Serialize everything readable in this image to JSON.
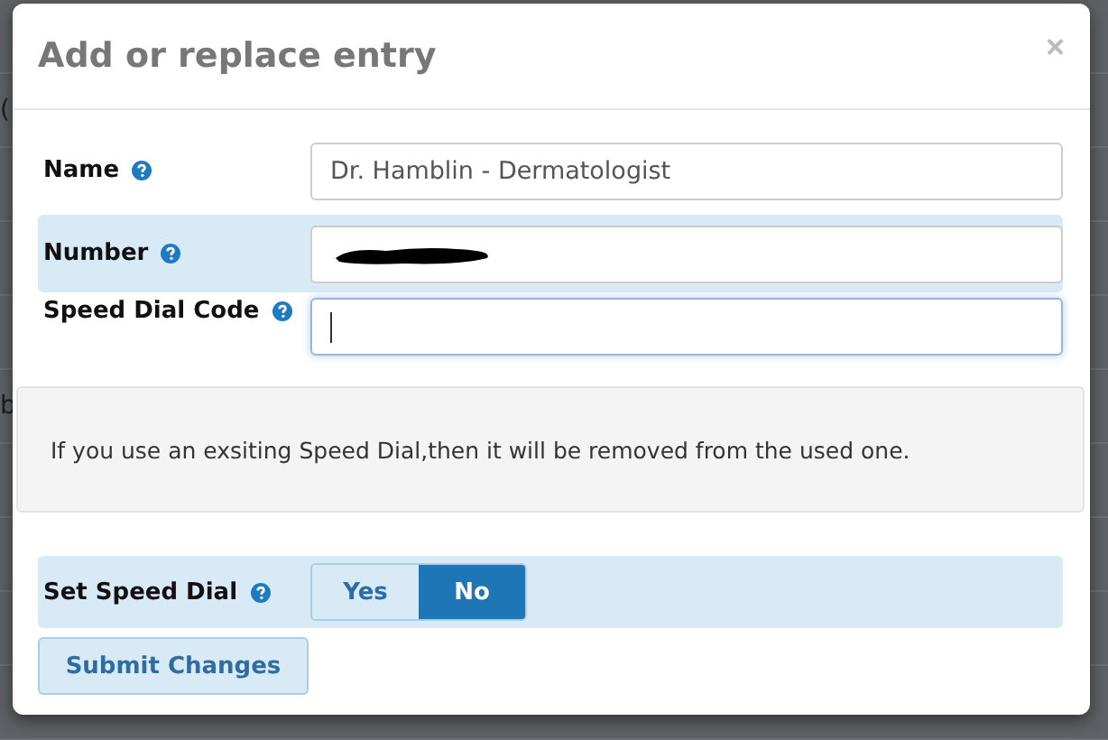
{
  "backdrop": {
    "fragments": [
      "(",
      "b"
    ]
  },
  "dialog": {
    "title": "Add or replace entry",
    "close": "×",
    "fields": [
      {
        "kind": "text",
        "label": "Name",
        "value": "Dr. Hamblin - Dermatologist",
        "highlighted": false,
        "focused": false,
        "redacted": false
      },
      {
        "kind": "text",
        "label": "Number",
        "highlighted": true,
        "focused": false,
        "redacted": true
      },
      {
        "kind": "text",
        "label": "Speed Dial Code",
        "highlighted": false,
        "focused": true,
        "redacted": false
      }
    ],
    "notice": "If you use an exsiting Speed Dial,then it will be removed from the used one.",
    "speed_dial": {
      "label": "Set Speed Dial",
      "options": [
        {
          "label": "Yes",
          "selected": false
        },
        {
          "label": "No",
          "selected": true
        }
      ]
    },
    "submit": "Submit Changes"
  }
}
